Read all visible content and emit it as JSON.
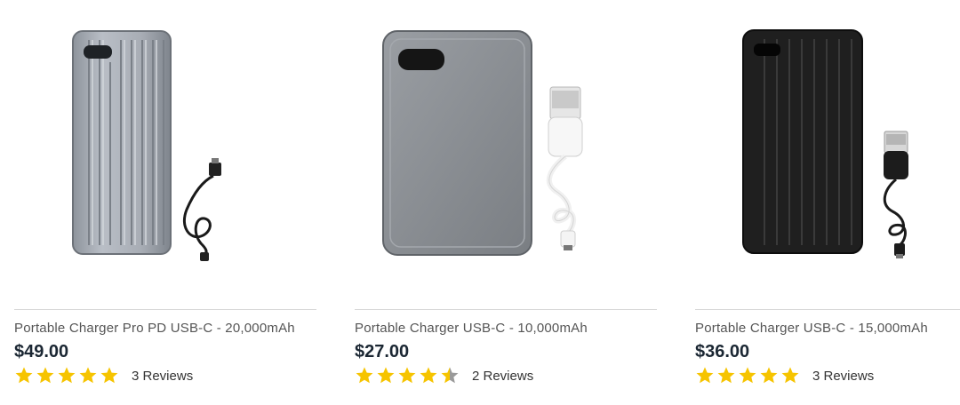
{
  "colors": {
    "star": "#f6c400",
    "star_empty": "#9a9a9a",
    "price": "#1b2733"
  },
  "products": [
    {
      "title": "Portable Charger Pro PD USB-C - 20,000mAh",
      "price": "$49.00",
      "rating": 5,
      "reviews": "3 Reviews",
      "image": "silver-ribbed-power-bank-with-usb-c-cable"
    },
    {
      "title": "Portable Charger USB-C - 10,000mAh",
      "price": "$27.00",
      "rating": 4.5,
      "reviews": "2 Reviews",
      "image": "grey-power-bank-with-white-usb-cable"
    },
    {
      "title": "Portable Charger USB-C - 15,000mAh",
      "price": "$36.00",
      "rating": 5,
      "reviews": "3 Reviews",
      "image": "black-ribbed-power-bank-with-usb-cable"
    }
  ]
}
